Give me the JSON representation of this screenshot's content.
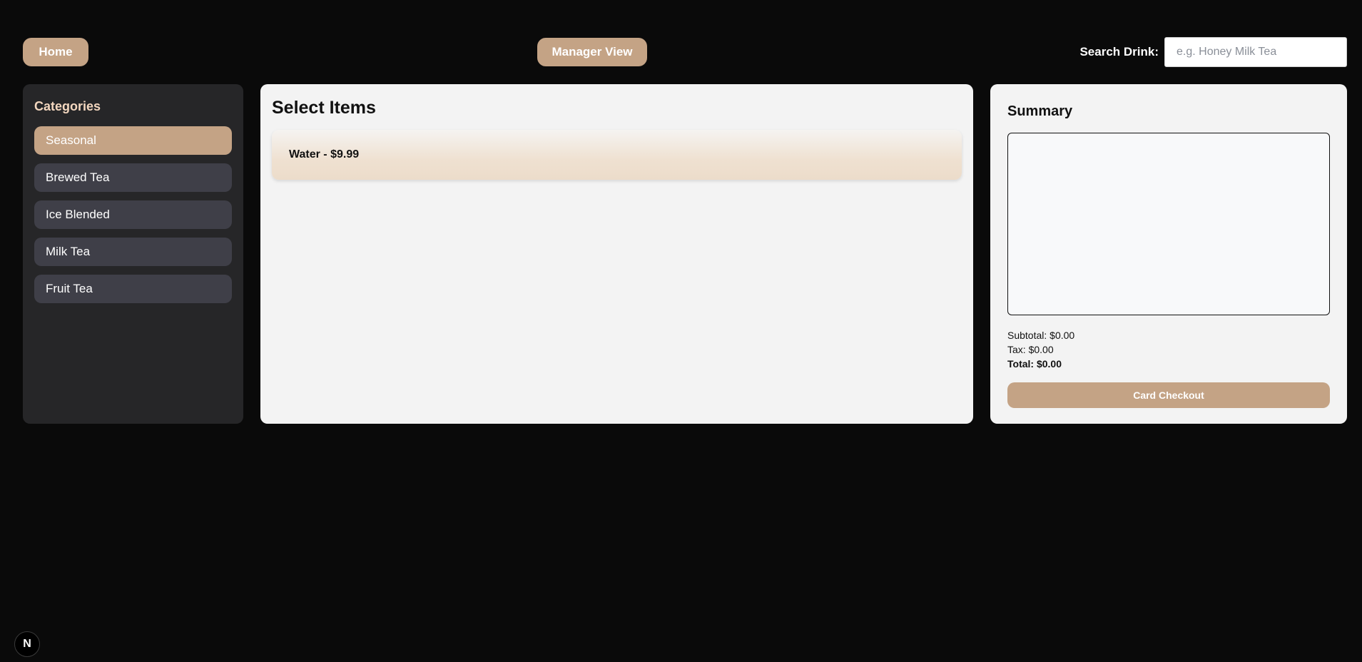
{
  "header": {
    "home_label": "Home",
    "manager_label": "Manager View",
    "search_label": "Search Drink:",
    "search_placeholder": "e.g. Honey Milk Tea",
    "search_value": ""
  },
  "sidebar": {
    "title": "Categories",
    "items": [
      {
        "label": "Seasonal",
        "active": true
      },
      {
        "label": "Brewed Tea",
        "active": false
      },
      {
        "label": "Ice Blended",
        "active": false
      },
      {
        "label": "Milk Tea",
        "active": false
      },
      {
        "label": "Fruit Tea",
        "active": false
      }
    ]
  },
  "main": {
    "title": "Select Items",
    "items": [
      {
        "label": "Water - $9.99"
      }
    ]
  },
  "summary": {
    "title": "Summary",
    "subtotal": "Subtotal: $0.00",
    "tax": "Tax: $0.00",
    "total": "Total: $0.00",
    "checkout_label": "Card Checkout"
  },
  "dev_indicator": {
    "letter": "N",
    "icon": "nextjs-logo-icon"
  },
  "colors": {
    "background": "#0a0a0a",
    "accent": "#c4a385",
    "sidebar_bg": "#262628",
    "category_bg": "#3f3f48",
    "category_title": "#f3d7bf",
    "panel_bg": "#f3f3f3"
  }
}
